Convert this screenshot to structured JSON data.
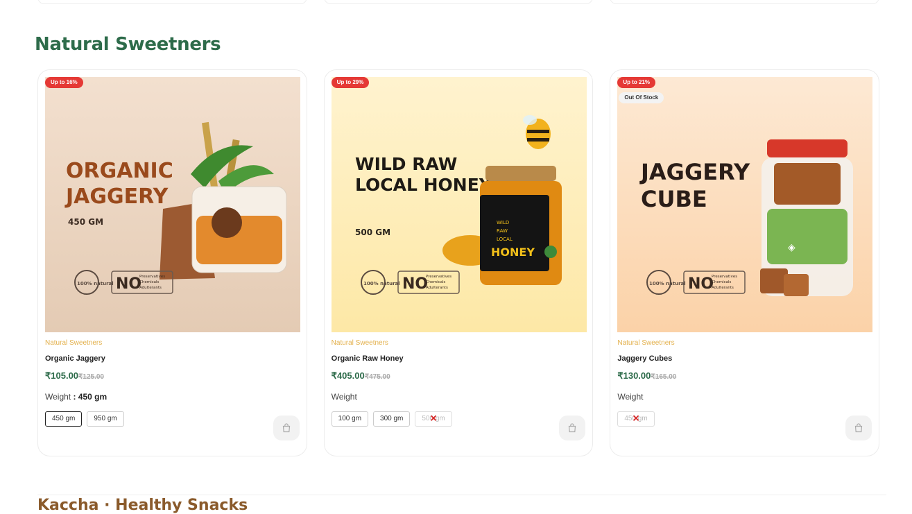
{
  "section": {
    "title": "Natural Sweetners"
  },
  "next_section": {
    "title": "Kaccha · Healthy Snacks"
  },
  "colors": {
    "title_green": "#2d6b4a",
    "badge_red": "#e53935",
    "category_gold": "#e3b04b"
  },
  "products": [
    {
      "badge": "Up to 16%",
      "category": "Natural Sweetners",
      "name": "Organic Jaggery",
      "price": "₹105.00",
      "old_price": "₹125.00",
      "weight_label": "Weight",
      "weight_value": " : 450 gm",
      "image": {
        "heading_1": "ORGANIC",
        "heading_2": "JAGGERY",
        "size": "450 GM",
        "natural_badge": "100% natural",
        "no_text": "NO",
        "no_lines": [
          "Preservatives",
          "Chemicals",
          "Adulterants"
        ],
        "bg_top": "#f3e0cf",
        "bg_bottom": "#e4cbb4"
      },
      "options": [
        {
          "label": "450 gm",
          "state": "selected"
        },
        {
          "label": "950 gm",
          "state": "normal"
        }
      ]
    },
    {
      "badge": "Up to 29%",
      "category": "Natural Sweetners",
      "name": "Organic Raw Honey",
      "price": "₹405.00",
      "old_price": "₹475.00",
      "weight_label": "Weight",
      "weight_value": "",
      "image": {
        "heading_1": "WILD RAW",
        "heading_2": "LOCAL HONEY",
        "size": "500 GM",
        "natural_badge": "100% natural",
        "no_text": "NO",
        "no_lines": [
          "Preservatives",
          "Chemicals",
          "Adulterants"
        ],
        "label_1": "WILD",
        "label_2": "RAW",
        "label_3": "LOCAL",
        "label_4": "HONEY",
        "bg_top": "#fff3cf",
        "bg_bottom": "#fde8a6"
      },
      "options": [
        {
          "label": "100 gm",
          "state": "normal"
        },
        {
          "label": "300 gm",
          "state": "normal"
        },
        {
          "label": "500 gm",
          "state": "disabled"
        }
      ]
    },
    {
      "badge": "Up to 21%",
      "stock_badge": "Out Of Stock",
      "category": "Natural Sweetners",
      "name": "Jaggery Cubes",
      "price": "₹130.00",
      "old_price": "₹165.00",
      "weight_label": "Weight",
      "weight_value": "",
      "image": {
        "heading_1": "JAGGERY",
        "heading_2": "CUBE",
        "natural_badge": "100% natural",
        "no_text": "NO",
        "no_lines": [
          "Preservatives",
          "Chemicals",
          "Adulterants"
        ],
        "bg_top": "#fde9d4",
        "bg_bottom": "#fbd2a8"
      },
      "options": [
        {
          "label": "450 gm",
          "state": "disabled"
        }
      ]
    }
  ]
}
